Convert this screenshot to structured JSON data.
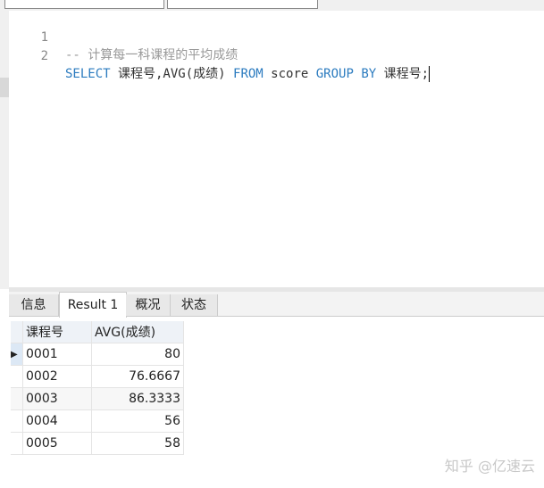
{
  "editor": {
    "lines": [
      {
        "num": "1",
        "comment": "-- 计算每一科课程的平均成绩"
      },
      {
        "num": "2",
        "kw1": "SELECT",
        "t1": " 课程号,AVG(成绩) ",
        "kw2": "FROM",
        "t2": " score ",
        "kw3": "GROUP BY",
        "t3": " 课程号;"
      }
    ]
  },
  "tabs": [
    "信息",
    "Result 1",
    "概况",
    "状态"
  ],
  "table": {
    "columns": [
      "课程号",
      "AVG(成绩)"
    ],
    "rows": [
      [
        "0001",
        "80"
      ],
      [
        "0002",
        "76.6667"
      ],
      [
        "0003",
        "86.3333"
      ],
      [
        "0004",
        "56"
      ],
      [
        "0005",
        "58"
      ]
    ]
  },
  "watermark": "知乎 @亿速云"
}
